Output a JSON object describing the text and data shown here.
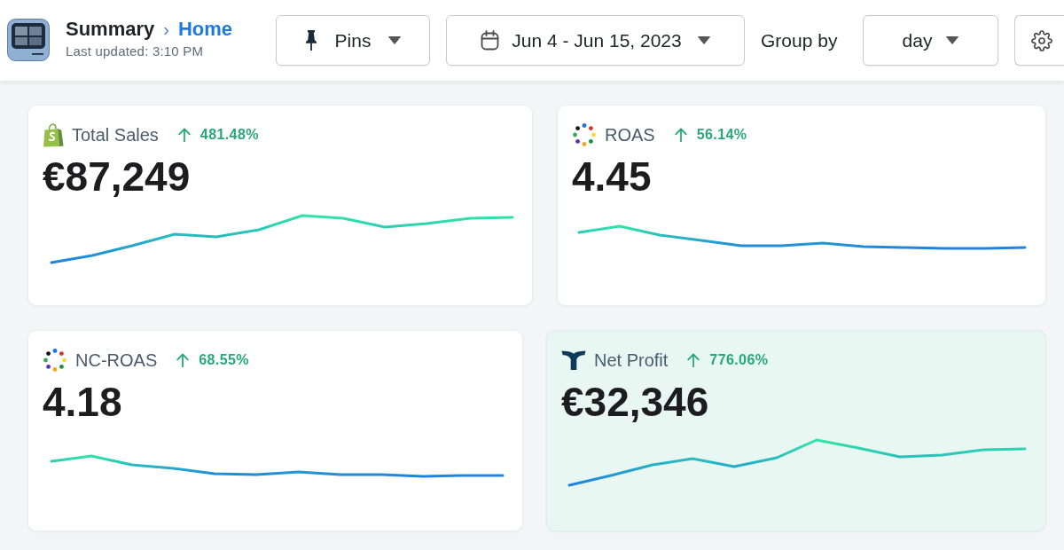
{
  "header": {
    "breadcrumb": [
      {
        "label": "Summary",
        "link": false
      },
      {
        "label": "Home",
        "link": true
      }
    ],
    "separator": "›",
    "last_updated": "Last updated: 3:10 PM"
  },
  "toolbar": {
    "pins": {
      "label": "Pins"
    },
    "date_range": {
      "label": "Jun 4 - Jun 15, 2023"
    },
    "group_by": {
      "label": "Group by",
      "value": "day"
    }
  },
  "cards": [
    {
      "kind": "shop",
      "title": "Total Sales",
      "increase": true,
      "change": "481.48%",
      "value": "€87,249",
      "highlighted": false
    },
    {
      "kind": "ads",
      "title": "ROAS",
      "increase": true,
      "change": "56.14%",
      "value": "4.45",
      "highlighted": false
    },
    {
      "kind": "ads",
      "title": "NC-ROAS",
      "increase": true,
      "change": "68.55%",
      "value": "4.18",
      "highlighted": false
    },
    {
      "kind": "profit",
      "title": "Net Profit",
      "increase": true,
      "change": "776.06%",
      "value": "€32,346",
      "highlighted": true
    }
  ]
}
